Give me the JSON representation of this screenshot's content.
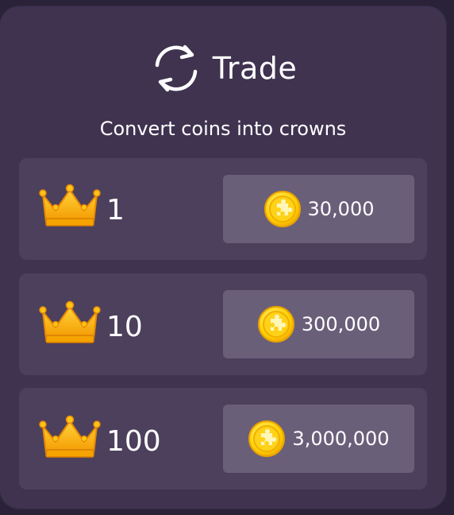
{
  "header": {
    "title": "Trade",
    "icon": "refresh-icon"
  },
  "subtitle": "Convert coins into crowns",
  "offers": [
    {
      "crowns": "1",
      "price": "30,000"
    },
    {
      "crowns": "10",
      "price": "300,000"
    },
    {
      "crowns": "100",
      "price": "3,000,000"
    }
  ],
  "colors": {
    "panel": "#3f3350",
    "row": "#4c405d",
    "button": "#6a5f79",
    "crown": "#f7b500",
    "coin": "#ffd21a"
  }
}
